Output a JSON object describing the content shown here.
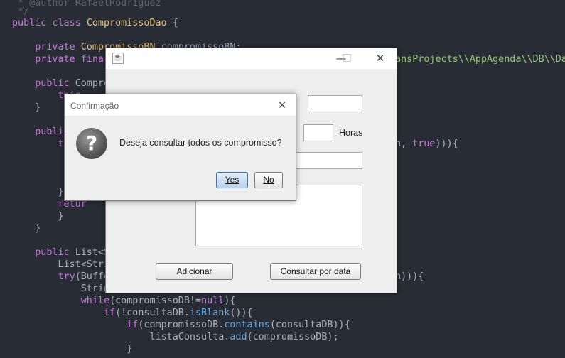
{
  "editor": {
    "lines": [
      " * @author RafaelRodriguez",
      " */",
      "public class CompromissoDao {",
      "",
      "    private CompromissoBN compromissoBN;",
      "    private final",
      "",
      "    public Compro",
      "        this.",
      "    }",
      "",
      "    public",
      "        t",
      "",
      "",
      "        }",
      "        retur",
      "        }",
      "    }",
      "",
      "    public List<S",
      "        List<Stri",
      "        try(Buffe",
      "            Strin",
      "            while(compromissoDB!=null){",
      "                if(!consultaDB.isBlank()){",
      "                    if(compromissoDB.contains(consultaDB)){",
      "                        listaConsulta.add(compromissoDB);",
      "                    }"
    ],
    "right_fragments": {
      "path_text": "eansProjects\\\\AppAgenda\\\\DB\\\\Da",
      "line_true": "th, true))){",
      "line_path": "th))){"
    }
  },
  "main_window": {
    "title_icon": "java-cup-icon",
    "minimize": "—",
    "maximize": "☐",
    "close": "✕",
    "hours_label": "Horas",
    "add_button": "Adicionar",
    "query_button": "Consultar por data"
  },
  "dialog": {
    "title": "Confirmação",
    "close": "✕",
    "icon": "question-icon",
    "message": "Deseja consultar todos os compromisso?",
    "yes_label": "Yes",
    "no_label": "No"
  }
}
